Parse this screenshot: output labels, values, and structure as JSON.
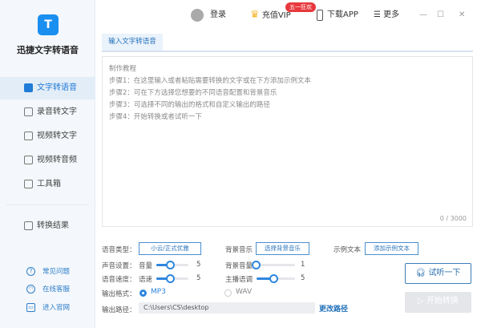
{
  "app": {
    "title": "迅捷文字转语音",
    "logo_letter": "T"
  },
  "sidebar": {
    "items": [
      {
        "label": "文字转语音",
        "icon": "text-speech-icon",
        "active": true
      },
      {
        "label": "录音转文字",
        "icon": "record-icon"
      },
      {
        "label": "视频转文字",
        "icon": "video-text-icon"
      },
      {
        "label": "视频转音频",
        "icon": "video-audio-icon"
      },
      {
        "label": "工具箱",
        "icon": "toolbox-icon"
      },
      {
        "label": "转换结果",
        "icon": "result-icon"
      }
    ],
    "help": [
      {
        "label": "常见问题",
        "icon": "question-icon",
        "glyph": "?"
      },
      {
        "label": "在线客服",
        "icon": "headset-icon",
        "glyph": "◠"
      },
      {
        "label": "进入官网",
        "icon": "monitor-icon",
        "glyph": "▭"
      }
    ]
  },
  "topbar": {
    "login": "登录",
    "vip": "充值VIP",
    "vip_badge": "五一狂欢",
    "download": "下载APP",
    "more": "更多",
    "minimize": "—",
    "maximize": "☐",
    "close": "✕"
  },
  "tab": {
    "label": "输入文字转语音"
  },
  "editor": {
    "placeholder": [
      "制作教程",
      "步骤1：在这里输入或者粘贴需要转换的文字或在下方添加示例文本",
      "步骤2：可在下方选择您想要的不同语音配置和背景音乐",
      "步骤3：可选择不同的输出的格式和自定义输出的路径",
      "步骤4：开始转换或者试听一下"
    ],
    "counter": "0 / 3000"
  },
  "settings": {
    "voice_type_label": "语音类型：",
    "voice_type_value": "小云/正式优雅",
    "bg_music_label": "背景音乐",
    "bg_music_button": "选择背景音乐",
    "sample_label": "示例文本",
    "sample_button": "添加示例文本",
    "sound_label": "声音设置：",
    "volume_label": "音量",
    "volume": "5",
    "bg_volume_label": "背景音量",
    "bg_volume": "1",
    "speed_row_label": "语音速度：",
    "speed_label": "语速",
    "speed": "5",
    "tone_label": "主播语调",
    "tone": "5",
    "format_label": "输出格式：",
    "format_mp3": "MP3",
    "format_wav": "WAV",
    "format_selected": "MP3",
    "path_label": "输出路径：",
    "path_value": "C:\\Users\\CS\\desktop",
    "change_path": "更改路径"
  },
  "actions": {
    "preview": "试听一下",
    "convert": "开始转换"
  },
  "colors": {
    "accent": "#2e86de",
    "vip_badge": "#e8383d",
    "vip_crown": "#f5b731"
  }
}
